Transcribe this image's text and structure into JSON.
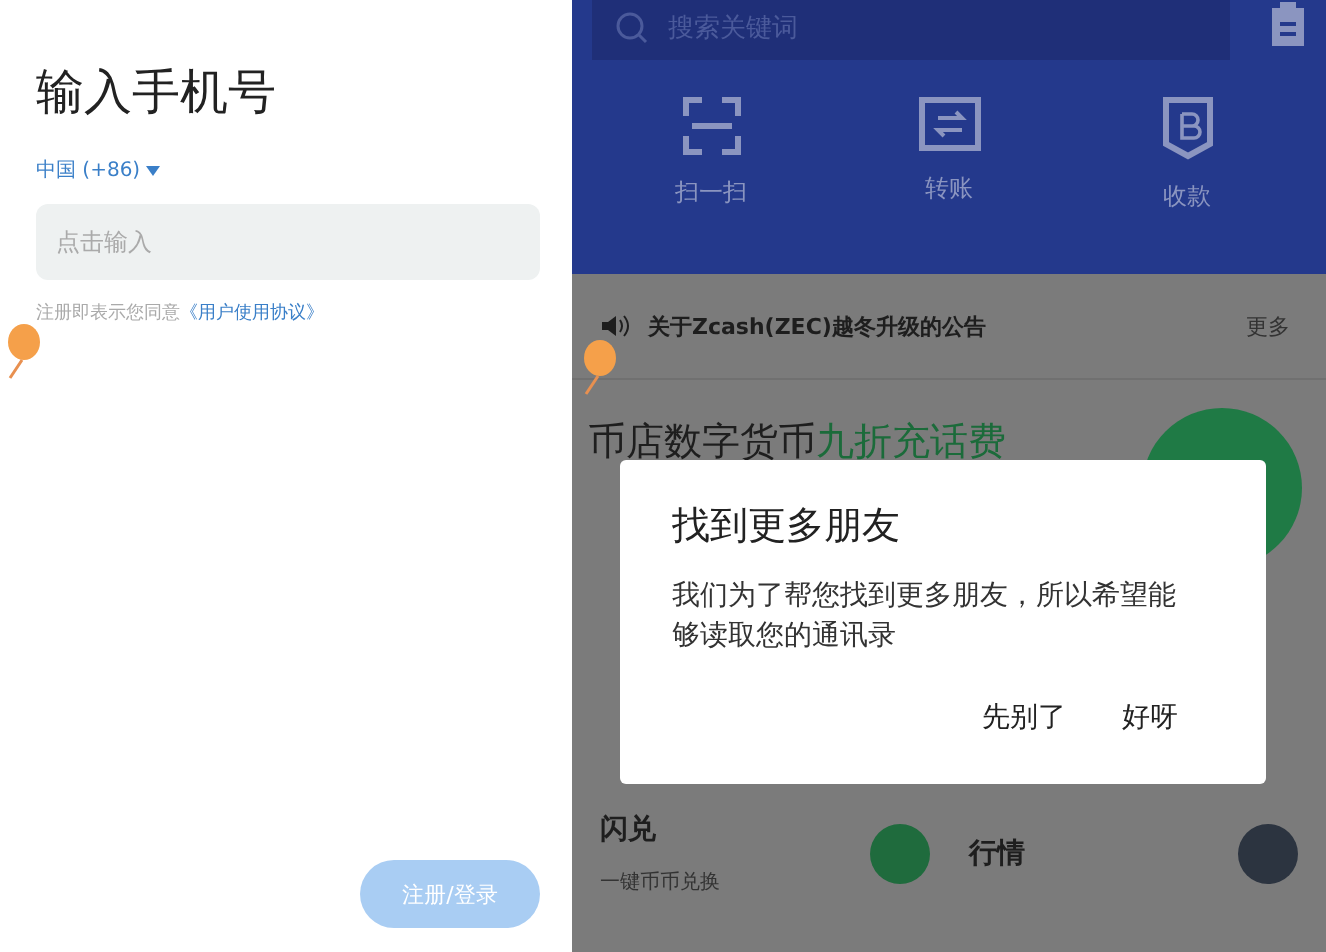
{
  "login": {
    "title": "输入手机号",
    "country": "中国 (+86)",
    "phone_field": {
      "placeholder": "点击输入"
    },
    "agreement": {
      "text": "注册即表示您同意",
      "link": "《用户使用协议》"
    },
    "submit_button": {
      "label": "注册/登录",
      "disabled": true
    }
  },
  "wallet": {
    "search": {
      "placeholder": "搜索关键词"
    },
    "actions": [
      {
        "kind": "scan",
        "label": "扫一扫"
      },
      {
        "kind": "transfer",
        "label": "转账"
      },
      {
        "kind": "receive",
        "label": "收款"
      }
    ],
    "notice": {
      "text": "关于Zcash(ZEC)越冬升级的公告",
      "more": "更多"
    },
    "banner": {
      "title": "币店数字货币",
      "highlight": "九折充话费"
    },
    "tiles": [
      {
        "title": "闪兑",
        "subtitle": "一键币币兑换"
      },
      {
        "title": "行情"
      }
    ]
  },
  "dialog": {
    "title": "找到更多朋友",
    "message": "我们为了帮您找到更多朋友，所以希望能够读取您的通讯录",
    "buttons": [
      "先别了",
      "好呀"
    ]
  }
}
